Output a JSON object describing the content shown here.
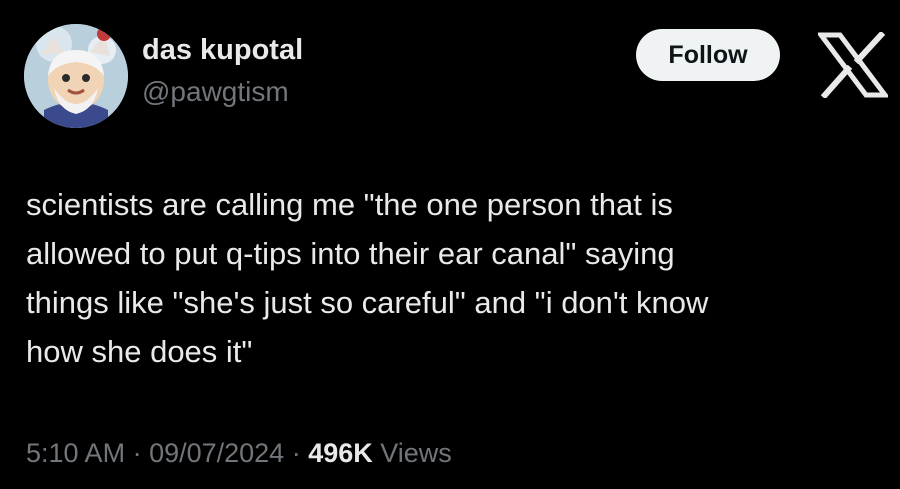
{
  "author": {
    "display_name": "das kupotal",
    "handle": "@pawgtism",
    "avatar_icon": "cartoon-character-avatar"
  },
  "header": {
    "follow_label": "Follow",
    "brand_icon": "x-logo-icon"
  },
  "tweet": {
    "text": "scientists are calling me \"the one person that is\nallowed to put q-tips into their ear canal\" saying\nthings like \"she's just so careful\" and \"i don't know\nhow she does it\""
  },
  "meta": {
    "time": "5:10 AM",
    "separator": " · ",
    "date": "09/07/2024",
    "views_count": "496K",
    "views_label": "Views"
  },
  "colors": {
    "background": "#000000",
    "primary_text": "#e7e9ea",
    "secondary_text": "#71767b",
    "follow_button_bg": "#eff3f4",
    "follow_button_text": "#0f1419"
  }
}
